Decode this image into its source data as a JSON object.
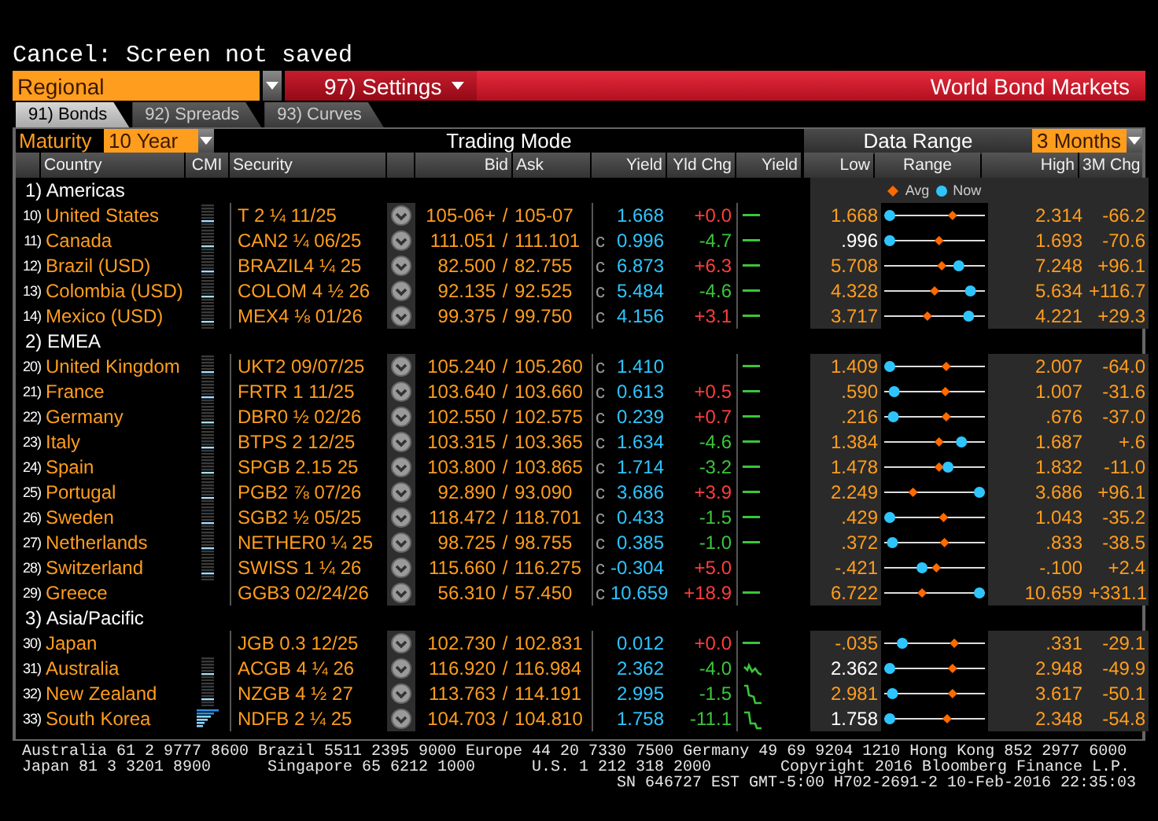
{
  "status_line": "Cancel: Screen not saved",
  "top_bar": {
    "view": "Regional",
    "settings": "97) Settings",
    "title": "World Bond Markets"
  },
  "tabs": [
    {
      "label": "91) Bonds",
      "selected": true
    },
    {
      "label": "92) Spreads",
      "selected": false
    },
    {
      "label": "93) Curves",
      "selected": false
    }
  ],
  "controls": {
    "maturity_label": "Maturity",
    "maturity": "10 Year",
    "mode": "Trading Mode",
    "range_label": "Data Range",
    "range": "3 Months"
  },
  "table": {
    "columns": [
      "Country",
      "CMI",
      "Security",
      "Bid",
      "Ask",
      "Yield",
      "Yld Chg",
      "Yield",
      "Low",
      "Range",
      "High",
      "3M Chg"
    ],
    "groups": [
      {
        "label": "1) Americas",
        "legend": {
          "avg": "Avg",
          "now": "Now"
        },
        "rows": [
          {
            "num": "10)",
            "country": "United States",
            "cmi_meter": true,
            "security": "T 2 ¼ 11/25",
            "bid": "105-06+",
            "separator": "/",
            "ask": "105-07",
            "yield": "1.668",
            "change": "+0.0",
            "rising": true,
            "trend_line": true,
            "low": "1.668",
            "at_low": false,
            "avg": {
              "level": 0.7
            },
            "now": {
              "level": 0
            },
            "high": "2.314",
            "chg_3m": "-66.2"
          },
          {
            "num": "11)",
            "country": "Canada",
            "cmi_meter": true,
            "security": "CAN2 ¼ 06/25",
            "bid": "111.051",
            "separator": "/",
            "ask": "111.101",
            "flag": "c",
            "yield": "0.996",
            "change": "-4.7",
            "rising": false,
            "trend_line": true,
            "low": ".996",
            "at_low": true,
            "avg": {
              "level": 0.55
            },
            "now": {
              "level": 0
            },
            "high": "1.693",
            "chg_3m": "-70.6"
          },
          {
            "num": "12)",
            "country": "Brazil (USD)",
            "cmi_meter": true,
            "security": "BRAZIL4 ¼ 25",
            "bid": "82.500",
            "separator": "/",
            "ask": "82.755",
            "flag": "c",
            "yield": "6.873",
            "change": "+6.3",
            "rising": true,
            "trend_line": true,
            "low": "5.708",
            "at_low": false,
            "avg": {
              "level": 0.58
            },
            "now": {
              "level": 0.77
            },
            "high": "7.248",
            "chg_3m": "+96.1"
          },
          {
            "num": "13)",
            "country": "Colombia (USD)",
            "cmi_meter": true,
            "security": "COLOM 4 ½ 26",
            "bid": "92.135",
            "separator": "/",
            "ask": "92.525",
            "flag": "c",
            "yield": "5.484",
            "change": "-4.6",
            "rising": false,
            "trend_line": true,
            "low": "4.328",
            "at_low": false,
            "avg": {
              "level": 0.5
            },
            "now": {
              "level": 0.9
            },
            "high": "5.634",
            "chg_3m": "+116.7"
          },
          {
            "num": "14)",
            "country": "Mexico (USD)",
            "cmi_meter": true,
            "security": "MEX4 ⅛ 01/26",
            "bid": "99.375",
            "separator": "/",
            "ask": "99.750",
            "flag": "c",
            "yield": "4.156",
            "change": "+3.1",
            "rising": true,
            "trend_line": true,
            "low": "3.717",
            "at_low": false,
            "avg": {
              "level": 0.42
            },
            "now": {
              "level": 0.88
            },
            "high": "4.221",
            "chg_3m": "+29.3"
          }
        ]
      },
      {
        "label": "2) EMEA",
        "rows": [
          {
            "num": "20)",
            "country": "United Kingdom",
            "cmi_meter": true,
            "security": "UKT2 09/07/25",
            "bid": "105.240",
            "separator": "/",
            "ask": "105.260",
            "flag": "c",
            "yield": "1.410",
            "trend_line": true,
            "low": "1.409",
            "at_low": false,
            "avg": {
              "level": 0.63
            },
            "now": {
              "level": 0
            },
            "high": "2.007",
            "chg_3m": "-64.0"
          },
          {
            "num": "21)",
            "country": "France",
            "cmi_meter": true,
            "security": "FRTR 1 11/25",
            "bid": "103.640",
            "separator": "/",
            "ask": "103.660",
            "flag": "c",
            "yield": "0.613",
            "change": "+0.5",
            "rising": true,
            "trend_line": true,
            "low": ".590",
            "at_low": false,
            "avg": {
              "level": 0.62
            },
            "now": {
              "level": 0.05
            },
            "high": "1.007",
            "chg_3m": "-31.6"
          },
          {
            "num": "22)",
            "country": "Germany",
            "cmi_meter": true,
            "security": "DBR0 ½ 02/26",
            "bid": "102.550",
            "separator": "/",
            "ask": "102.575",
            "flag": "c",
            "yield": "0.239",
            "change": "+0.7",
            "rising": true,
            "trend_line": true,
            "low": ".216",
            "at_low": false,
            "avg": {
              "level": 0.63
            },
            "now": {
              "level": 0.04
            },
            "high": ".676",
            "chg_3m": "-37.0"
          },
          {
            "num": "23)",
            "country": "Italy",
            "cmi_meter": true,
            "security": "BTPS 2 12/25",
            "bid": "103.315",
            "separator": "/",
            "ask": "103.365",
            "flag": "c",
            "yield": "1.634",
            "change": "-4.6",
            "rising": false,
            "trend_line": true,
            "low": "1.384",
            "at_low": false,
            "avg": {
              "level": 0.55
            },
            "now": {
              "level": 0.8
            },
            "high": "1.687",
            "chg_3m": "+.6"
          },
          {
            "num": "24)",
            "country": "Spain",
            "cmi_meter": true,
            "security": "SPGB 2.15 25",
            "bid": "103.800",
            "separator": "/",
            "ask": "103.865",
            "flag": "c",
            "yield": "1.714",
            "change": "-3.2",
            "rising": false,
            "trend_line": true,
            "low": "1.478",
            "at_low": false,
            "avg": {
              "level": 0.55
            },
            "now": {
              "level": 0.65
            },
            "high": "1.832",
            "chg_3m": "-11.0"
          },
          {
            "num": "25)",
            "country": "Portugal",
            "cmi_meter": true,
            "security": "PGB2 ⅞ 07/26",
            "bid": "92.890",
            "separator": "/",
            "ask": "93.090",
            "flag": "c",
            "yield": "3.686",
            "change": "+3.9",
            "rising": true,
            "trend_line": true,
            "low": "2.249",
            "at_low": false,
            "avg": {
              "level": 0.26
            },
            "now": {
              "level": 1
            },
            "high": "3.686",
            "chg_3m": "+96.1"
          },
          {
            "num": "26)",
            "country": "Sweden",
            "cmi_meter": true,
            "security": "SGB2 ½ 05/25",
            "bid": "118.472",
            "separator": "/",
            "ask": "118.701",
            "flag": "c",
            "yield": "0.433",
            "change": "-1.5",
            "rising": false,
            "trend_line": true,
            "low": ".429",
            "at_low": false,
            "avg": {
              "level": 0.6
            },
            "now": {
              "level": 0
            },
            "high": "1.043",
            "chg_3m": "-35.2"
          },
          {
            "num": "27)",
            "country": "Netherlands",
            "cmi_meter": true,
            "security": "NETHER0 ¼ 25",
            "bid": "98.725",
            "separator": "/",
            "ask": "98.755",
            "flag": "c",
            "yield": "0.385",
            "change": "-1.0",
            "rising": false,
            "trend_line": true,
            "low": ".372",
            "at_low": false,
            "avg": {
              "level": 0.61
            },
            "now": {
              "level": 0.03
            },
            "high": ".833",
            "chg_3m": "-38.5"
          },
          {
            "num": "28)",
            "country": "Switzerland",
            "cmi_meter": true,
            "security": "SWISS 1 ¼ 26",
            "bid": "115.660",
            "separator": "/",
            "ask": "116.275",
            "flag": "c",
            "yield": "-0.304",
            "change": "+5.0",
            "rising": true,
            "trend_line": false,
            "low": "-.421",
            "at_low": false,
            "avg": {
              "level": 0.52
            },
            "now": {
              "level": 0.36
            },
            "high": "-.100",
            "chg_3m": "+2.4"
          },
          {
            "num": "29)",
            "country": "Greece",
            "cmi_meter": false,
            "security": "GGB3 02/24/26",
            "bid": "56.310",
            "separator": "/",
            "ask": "57.450",
            "flag": "c",
            "yield": "10.659",
            "change": "+18.9",
            "rising": true,
            "trend_line": true,
            "low": "6.722",
            "at_low": false,
            "avg": {
              "level": 0.36
            },
            "now": {
              "level": 1
            },
            "high": "10.659",
            "chg_3m": "+331.1"
          }
        ]
      },
      {
        "label": "3) Asia/Pacific",
        "rows": [
          {
            "num": "30)",
            "country": "Japan",
            "cmi_meter": false,
            "security": "JGB 0.3 12/25",
            "bid": "102.730",
            "separator": "/",
            "ask": "102.831",
            "yield": "0.012",
            "change": "+0.0",
            "rising": true,
            "trend_line": true,
            "low": "-.035",
            "at_low": false,
            "avg": {
              "level": 0.72
            },
            "now": {
              "level": 0.14
            },
            "high": ".331",
            "chg_3m": "-29.1"
          },
          {
            "num": "31)",
            "country": "Australia",
            "cmi_meter": true,
            "security": "ACGB 4 ¼ 26",
            "bid": "116.920",
            "separator": "/",
            "ask": "116.984",
            "yield": "2.362",
            "change": "-4.0",
            "rising": false,
            "sparkline": true,
            "low": "2.362",
            "at_low": true,
            "avg": {
              "level": 0.7
            },
            "now": {
              "level": 0
            },
            "high": "2.948",
            "chg_3m": "-49.9"
          },
          {
            "num": "32)",
            "country": "New Zealand",
            "cmi_meter": true,
            "security": "NZGB 4 ½ 27",
            "bid": "113.763",
            "separator": "/",
            "ask": "114.191",
            "yield": "2.995",
            "change": "-1.5",
            "rising": false,
            "sparkline": true,
            "low": "2.981",
            "at_low": false,
            "avg": {
              "level": 0.7
            },
            "now": {
              "level": 0.03
            },
            "high": "3.617",
            "chg_3m": "-50.1"
          },
          {
            "num": "33)",
            "country": "South Korea",
            "cmi_bars": true,
            "security": "NDFB 2 ¼ 25",
            "bid": "104.703",
            "separator": "/",
            "ask": "104.810",
            "yield": "1.758",
            "change": "-11.1",
            "rising": false,
            "sparkline": true,
            "low": "1.758",
            "at_low": true,
            "avg": {
              "level": 0.64
            },
            "now": {
              "level": 0
            },
            "high": "2.348",
            "chg_3m": "-54.8"
          }
        ]
      }
    ]
  },
  "footer": {
    "line_1": "Australia 61 2 9777 8600 Brazil 5511 2395 9000 Europe 44 20 7330 7500 Germany 49 69 9204 1210 Hong Kong 852 2977 6000",
    "line_2": [
      "Japan 81 3 3201 8900",
      "Singapore 65 6212 1000",
      "U.S. 1 212 318 2000",
      "Copyright 2016 Bloomberg Finance L.P."
    ],
    "line_3": "SN 646727 EST  GMT-5:00 H702-2691-2 10-Feb-2016 22:35:03"
  }
}
